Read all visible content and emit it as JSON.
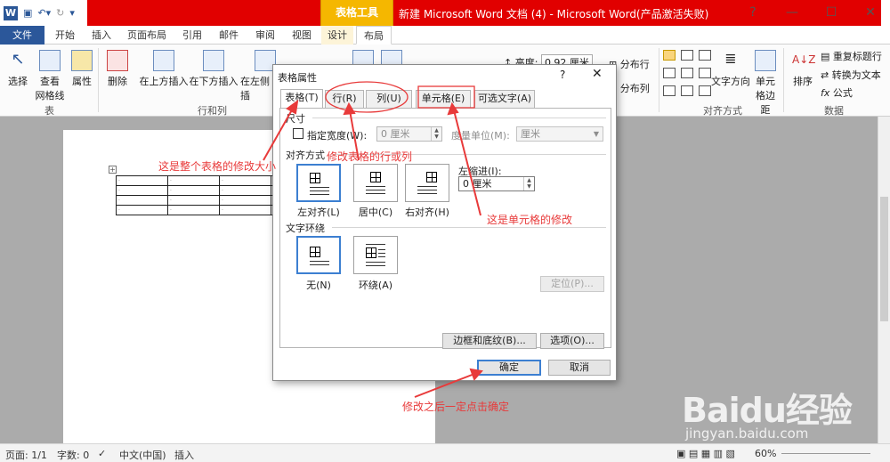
{
  "titlebar": {
    "app_icon": "W",
    "context_tab_group": "表格工具",
    "title": "新建 Microsoft Word 文档 (4) - Microsoft Word(产品激活失败)",
    "help": "?",
    "minimize": "—",
    "restore": "☐",
    "close": "✕"
  },
  "tabs": [
    "文件",
    "开始",
    "插入",
    "页面布局",
    "引用",
    "邮件",
    "审阅",
    "视图",
    "设计",
    "布局"
  ],
  "ribbon": {
    "table_group": {
      "select": "选择",
      "gridlines_1": "查看",
      "gridlines_2": "网格线",
      "properties": "属性",
      "label": "表"
    },
    "rowcol_group": {
      "delete": "删除",
      "insert_above": "在上方插入",
      "insert_below": "在下方插入",
      "insert_left": "在左侧插",
      "label": "行和列"
    },
    "cellsize_group": {
      "height_label": "高度:",
      "height_value": "0.92 厘米",
      "distribute_rows": "分布行",
      "distribute_cols": "分布列"
    },
    "align_group": {
      "text_direction": "文字方向",
      "cell_margins_1": "单元",
      "cell_margins_2": "格边距",
      "label": "对齐方式"
    },
    "data_group": {
      "sort": "排序",
      "repeat_header": "重复标题行",
      "convert": "转换为文本",
      "formula": "公式",
      "label": "数据"
    }
  },
  "dialog": {
    "title": "表格属性",
    "help": "?",
    "close": "✕",
    "tabs": [
      "表格(T)",
      "行(R)",
      "列(U)",
      "单元格(E)",
      "可选文字(A)"
    ],
    "size_section": "尺寸",
    "preferred_width_label": "指定宽度(W):",
    "width_value": "0 厘米",
    "measure_label": "度量单位(M):",
    "measure_value": "厘米",
    "alignment_section": "对齐方式",
    "align_options": [
      "左对齐(L)",
      "居中(C)",
      "右对齐(H)"
    ],
    "indent_label": "左缩进(I):",
    "indent_value": "0 厘米",
    "wrap_section": "文字环绕",
    "wrap_options": [
      "无(N)",
      "环绕(A)"
    ],
    "positioning_button": "定位(P)...",
    "borders_button": "边框和底纹(B)...",
    "options_button": "选项(O)...",
    "ok_button": "确定",
    "cancel_button": "取消"
  },
  "annotations": {
    "table_note": "这是整个表格的修改大小",
    "rowcol_note": "修改表格的行或列",
    "cell_note": "这是单元格的修改",
    "confirm_note": "修改之后一定点击确定",
    "color": "#e83a3a"
  },
  "statusbar": {
    "page": "页面: 1/1",
    "words": "字数: 0",
    "language": "中文(中国)",
    "mode": "插入",
    "zoom": "60%"
  },
  "watermark": {
    "brand": "Baidu经验",
    "url": "jingyan.baidu.com"
  }
}
